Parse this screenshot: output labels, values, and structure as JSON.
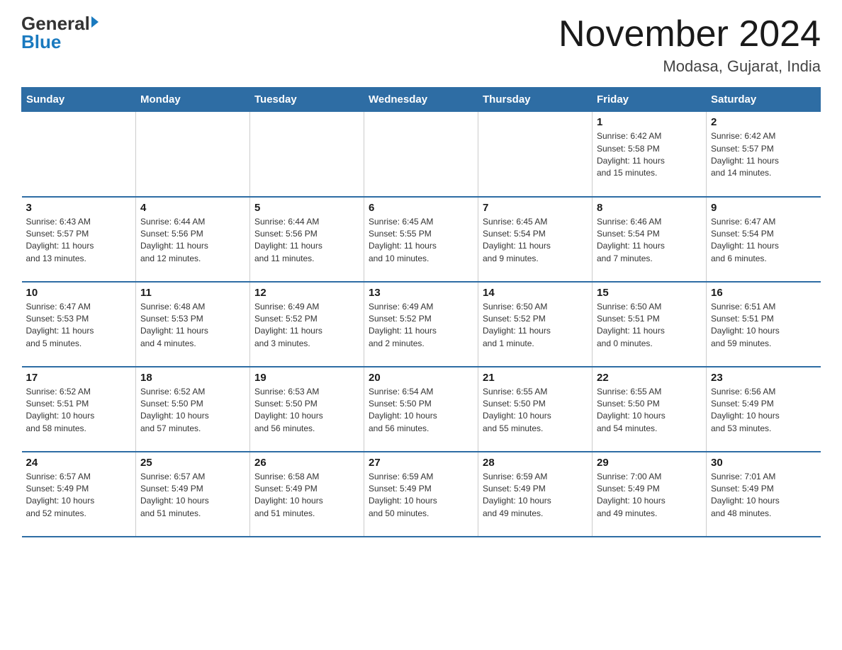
{
  "logo": {
    "general": "General",
    "blue": "Blue",
    "tagline": ""
  },
  "header": {
    "title": "November 2024",
    "location": "Modasa, Gujarat, India"
  },
  "days_of_week": [
    "Sunday",
    "Monday",
    "Tuesday",
    "Wednesday",
    "Thursday",
    "Friday",
    "Saturday"
  ],
  "weeks": [
    [
      {
        "day": "",
        "info": ""
      },
      {
        "day": "",
        "info": ""
      },
      {
        "day": "",
        "info": ""
      },
      {
        "day": "",
        "info": ""
      },
      {
        "day": "",
        "info": ""
      },
      {
        "day": "1",
        "info": "Sunrise: 6:42 AM\nSunset: 5:58 PM\nDaylight: 11 hours\nand 15 minutes."
      },
      {
        "day": "2",
        "info": "Sunrise: 6:42 AM\nSunset: 5:57 PM\nDaylight: 11 hours\nand 14 minutes."
      }
    ],
    [
      {
        "day": "3",
        "info": "Sunrise: 6:43 AM\nSunset: 5:57 PM\nDaylight: 11 hours\nand 13 minutes."
      },
      {
        "day": "4",
        "info": "Sunrise: 6:44 AM\nSunset: 5:56 PM\nDaylight: 11 hours\nand 12 minutes."
      },
      {
        "day": "5",
        "info": "Sunrise: 6:44 AM\nSunset: 5:56 PM\nDaylight: 11 hours\nand 11 minutes."
      },
      {
        "day": "6",
        "info": "Sunrise: 6:45 AM\nSunset: 5:55 PM\nDaylight: 11 hours\nand 10 minutes."
      },
      {
        "day": "7",
        "info": "Sunrise: 6:45 AM\nSunset: 5:54 PM\nDaylight: 11 hours\nand 9 minutes."
      },
      {
        "day": "8",
        "info": "Sunrise: 6:46 AM\nSunset: 5:54 PM\nDaylight: 11 hours\nand 7 minutes."
      },
      {
        "day": "9",
        "info": "Sunrise: 6:47 AM\nSunset: 5:54 PM\nDaylight: 11 hours\nand 6 minutes."
      }
    ],
    [
      {
        "day": "10",
        "info": "Sunrise: 6:47 AM\nSunset: 5:53 PM\nDaylight: 11 hours\nand 5 minutes."
      },
      {
        "day": "11",
        "info": "Sunrise: 6:48 AM\nSunset: 5:53 PM\nDaylight: 11 hours\nand 4 minutes."
      },
      {
        "day": "12",
        "info": "Sunrise: 6:49 AM\nSunset: 5:52 PM\nDaylight: 11 hours\nand 3 minutes."
      },
      {
        "day": "13",
        "info": "Sunrise: 6:49 AM\nSunset: 5:52 PM\nDaylight: 11 hours\nand 2 minutes."
      },
      {
        "day": "14",
        "info": "Sunrise: 6:50 AM\nSunset: 5:52 PM\nDaylight: 11 hours\nand 1 minute."
      },
      {
        "day": "15",
        "info": "Sunrise: 6:50 AM\nSunset: 5:51 PM\nDaylight: 11 hours\nand 0 minutes."
      },
      {
        "day": "16",
        "info": "Sunrise: 6:51 AM\nSunset: 5:51 PM\nDaylight: 10 hours\nand 59 minutes."
      }
    ],
    [
      {
        "day": "17",
        "info": "Sunrise: 6:52 AM\nSunset: 5:51 PM\nDaylight: 10 hours\nand 58 minutes."
      },
      {
        "day": "18",
        "info": "Sunrise: 6:52 AM\nSunset: 5:50 PM\nDaylight: 10 hours\nand 57 minutes."
      },
      {
        "day": "19",
        "info": "Sunrise: 6:53 AM\nSunset: 5:50 PM\nDaylight: 10 hours\nand 56 minutes."
      },
      {
        "day": "20",
        "info": "Sunrise: 6:54 AM\nSunset: 5:50 PM\nDaylight: 10 hours\nand 56 minutes."
      },
      {
        "day": "21",
        "info": "Sunrise: 6:55 AM\nSunset: 5:50 PM\nDaylight: 10 hours\nand 55 minutes."
      },
      {
        "day": "22",
        "info": "Sunrise: 6:55 AM\nSunset: 5:50 PM\nDaylight: 10 hours\nand 54 minutes."
      },
      {
        "day": "23",
        "info": "Sunrise: 6:56 AM\nSunset: 5:49 PM\nDaylight: 10 hours\nand 53 minutes."
      }
    ],
    [
      {
        "day": "24",
        "info": "Sunrise: 6:57 AM\nSunset: 5:49 PM\nDaylight: 10 hours\nand 52 minutes."
      },
      {
        "day": "25",
        "info": "Sunrise: 6:57 AM\nSunset: 5:49 PM\nDaylight: 10 hours\nand 51 minutes."
      },
      {
        "day": "26",
        "info": "Sunrise: 6:58 AM\nSunset: 5:49 PM\nDaylight: 10 hours\nand 51 minutes."
      },
      {
        "day": "27",
        "info": "Sunrise: 6:59 AM\nSunset: 5:49 PM\nDaylight: 10 hours\nand 50 minutes."
      },
      {
        "day": "28",
        "info": "Sunrise: 6:59 AM\nSunset: 5:49 PM\nDaylight: 10 hours\nand 49 minutes."
      },
      {
        "day": "29",
        "info": "Sunrise: 7:00 AM\nSunset: 5:49 PM\nDaylight: 10 hours\nand 49 minutes."
      },
      {
        "day": "30",
        "info": "Sunrise: 7:01 AM\nSunset: 5:49 PM\nDaylight: 10 hours\nand 48 minutes."
      }
    ]
  ]
}
